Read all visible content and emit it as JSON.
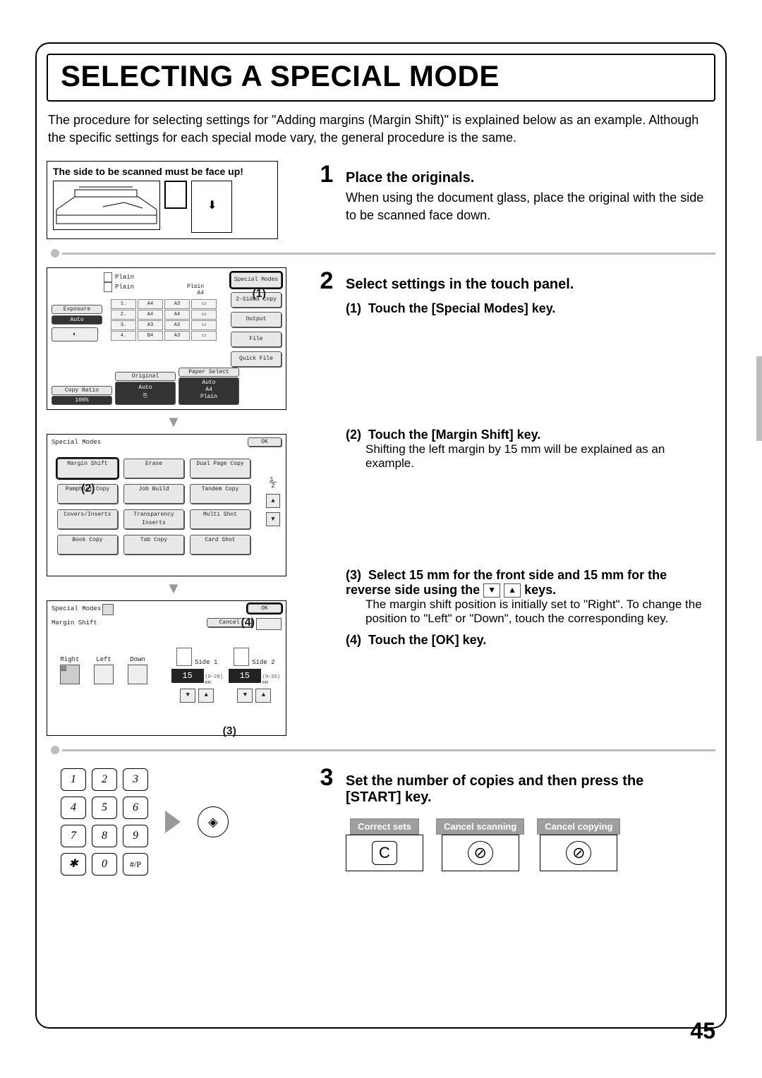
{
  "page_number": "45",
  "title": "SELECTING A SPECIAL MODE",
  "intro": "The procedure for selecting settings for \"Adding margins (Margin Shift)\" is explained below as an example. Although the specific settings for each special mode vary, the general procedure is the same.",
  "scan_note": "The side to be scanned must be face up!",
  "steps": {
    "s1": {
      "num": "1",
      "title": "Place the originals.",
      "body": "When using the document glass, place the original with the side to be scanned face down."
    },
    "s2": {
      "num": "2",
      "title": "Select settings in the touch panel.",
      "subs": {
        "a": {
          "n": "(1)",
          "t": "Touch the [Special Modes] key."
        },
        "b": {
          "n": "(2)",
          "t": "Touch the [Margin Shift] key.",
          "d": "Shifting the left margin by 15 mm will be explained as an example."
        },
        "c": {
          "n": "(3)",
          "t": "Select 15 mm for the front side and 15 mm for the reverse side using the ",
          "t2": " keys.",
          "d1": "The margin shift position is initially set to \"Right\". To change the position to \"Left\" or \"Down\", touch the corresponding key."
        },
        "d": {
          "n": "(4)",
          "t": "Touch the [OK] key."
        }
      }
    },
    "s3": {
      "num": "3",
      "title": "Set the number of copies and then press the [START] key."
    }
  },
  "panel2a": {
    "plain": "Plain",
    "a4": "A4",
    "btns": {
      "special": "Special Modes",
      "copy": "2-Sided Copy",
      "output": "Output",
      "file": "File",
      "quick": "Quick File"
    },
    "left": {
      "exposure": "Exposure",
      "auto": "Auto"
    },
    "bottom": {
      "copy_ratio": "Copy Ratio",
      "ratio": "100%",
      "original": "Original",
      "original_val": "Auto",
      "paper": "Paper Select",
      "paper_val": "Auto",
      "paper_val2": "A4",
      "paper_val3": "Plain"
    },
    "callout": "(1)"
  },
  "panel2b": {
    "hdr": "Special Modes",
    "ok": "OK",
    "page": "1",
    "pages": "2",
    "items": [
      "Margin Shift",
      "Erase",
      "Dual Page Copy",
      "Pamphlet Copy",
      "Job Build",
      "Tandem Copy",
      "Covers/Inserts",
      "Transparency Inserts",
      "Multi Shot",
      "Book Copy",
      "Tab Copy",
      "Card Shot"
    ],
    "callout": "(2)"
  },
  "panel2c": {
    "hdr": "Special Modes",
    "ok": "OK",
    "sub": "Margin Shift",
    "cancel": "Cancel",
    "pos": [
      "Right",
      "Left",
      "Down"
    ],
    "side1": "Side 1",
    "side2": "Side 2",
    "val": "15",
    "range": "(0~20)",
    "unit": "mm",
    "callout3": "(3)",
    "callout4": "(4)"
  },
  "keypad": [
    "1",
    "2",
    "3",
    "4",
    "5",
    "6",
    "7",
    "8",
    "9",
    "✱",
    "0",
    "#/P"
  ],
  "start_symbol": "◈",
  "boxes": {
    "correct": "Correct sets",
    "c": "C",
    "scan": "Cancel scanning",
    "copy": "Cancel copying",
    "stop": "⊘"
  }
}
